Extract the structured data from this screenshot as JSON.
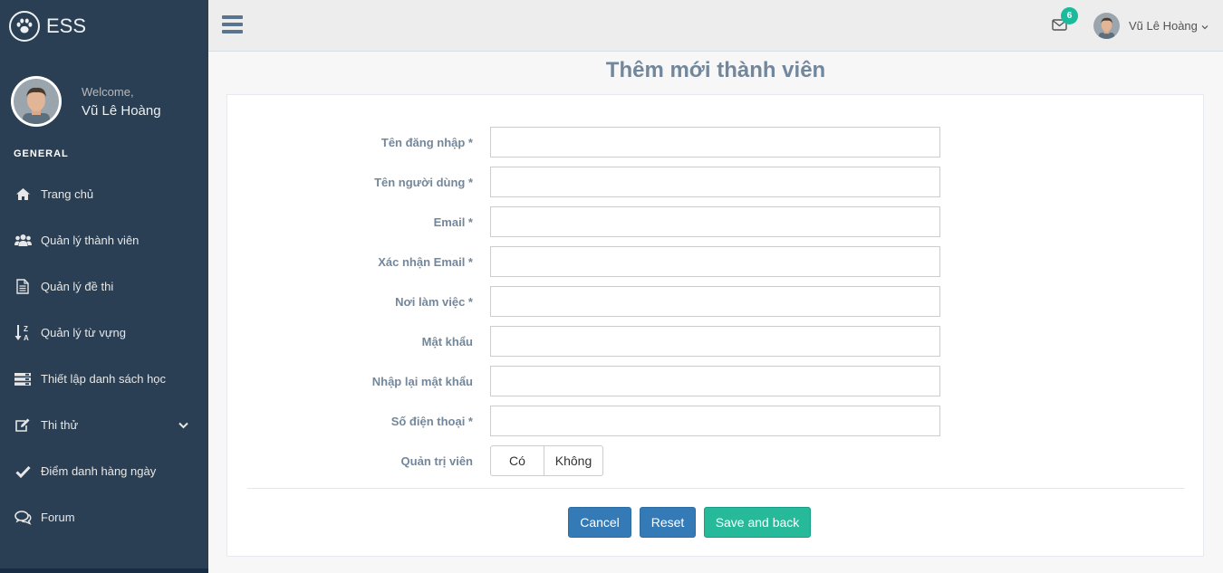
{
  "brand": {
    "title": "ESS",
    "icon": "paw-icon"
  },
  "profile": {
    "welcome": "Welcome,",
    "name": "Vũ Lê Hoàng"
  },
  "sidebar": {
    "section_title": "GENERAL",
    "items": [
      {
        "label": "Trang chủ",
        "icon": "home-icon"
      },
      {
        "label": "Quản lý thành viên",
        "icon": "users-icon"
      },
      {
        "label": "Quản lý đề thi",
        "icon": "document-icon"
      },
      {
        "label": "Quản lý từ vựng",
        "icon": "sort-alpha-icon"
      },
      {
        "label": "Thiết lập danh sách học",
        "icon": "list-icon"
      },
      {
        "label": "Thi thử",
        "icon": "edit-icon",
        "has_submenu": true
      },
      {
        "label": "Điểm danh hàng ngày",
        "icon": "check-icon"
      },
      {
        "label": "Forum",
        "icon": "comments-icon"
      }
    ]
  },
  "topnav": {
    "mail_badge": "6",
    "user_name": "Vũ Lê Hoàng"
  },
  "page": {
    "title": "Thêm mới thành viên"
  },
  "form": {
    "fields": [
      {
        "label": "Tên đăng nhập *",
        "value": ""
      },
      {
        "label": "Tên người dùng *",
        "value": ""
      },
      {
        "label": "Email *",
        "value": ""
      },
      {
        "label": "Xác nhận Email *",
        "value": ""
      },
      {
        "label": "Nơi làm việc *",
        "value": ""
      },
      {
        "label": "Mật khẩu",
        "value": ""
      },
      {
        "label": "Nhập lại mật khẩu",
        "value": ""
      },
      {
        "label": "Số điện thoại *",
        "value": ""
      }
    ],
    "admin": {
      "label": "Quản trị viên",
      "yes": "Có",
      "no": "Không"
    },
    "buttons": {
      "cancel": "Cancel",
      "reset": "Reset",
      "save": "Save and back"
    }
  },
  "colors": {
    "sidebar": "#2a3f54",
    "primary": "#337ab7",
    "success": "#26B99A",
    "badge": "#1ABB9C"
  }
}
